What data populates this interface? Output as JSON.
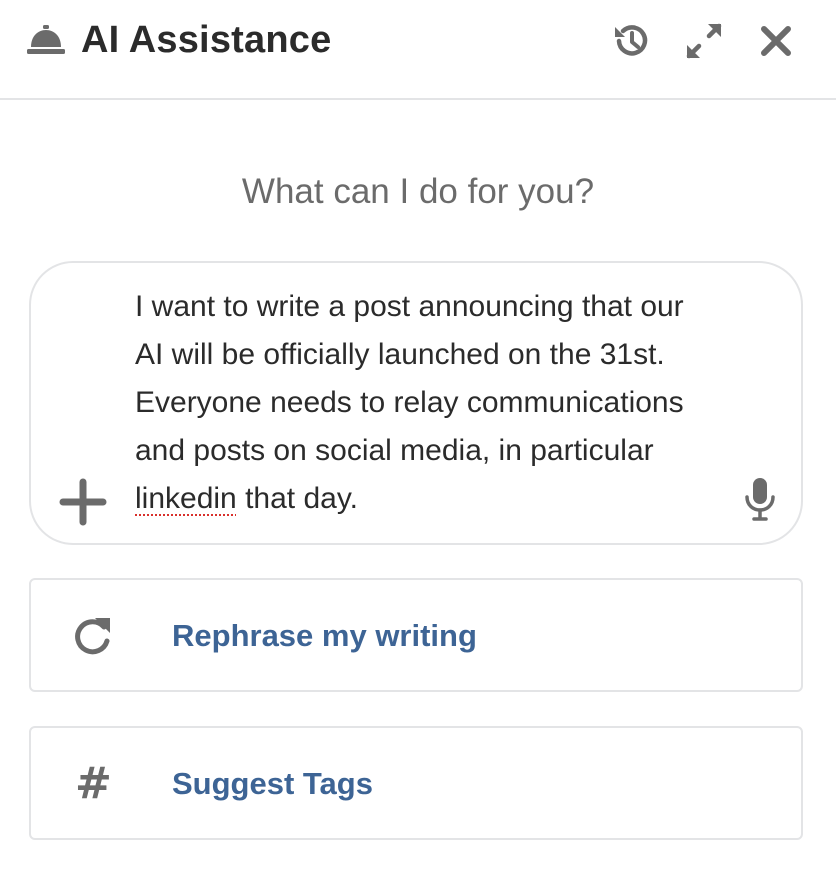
{
  "header": {
    "title": "AI Assistance",
    "icons": [
      "bell-icon",
      "history-icon",
      "expand-icon",
      "close-icon"
    ]
  },
  "main": {
    "prompt": "What can I do for you?",
    "input": {
      "text_before": "I want to write a post announcing that our\nAI will be officially launched on the 31st.\nEveryone needs to relay communications\nand posts on social media, in particular\n",
      "misspelled_word": "linkedin",
      "text_after": " that day."
    },
    "actions": [
      {
        "label": "Rephrase my writing",
        "icon": "refresh-icon"
      },
      {
        "label": "Suggest Tags",
        "icon": "hash-icon",
        "glyph": "#"
      }
    ]
  },
  "colors": {
    "accent": "#3d6495",
    "icon_gray": "#6b6b6b",
    "border": "#e3e4e6",
    "spell_error": "#d9302c"
  }
}
